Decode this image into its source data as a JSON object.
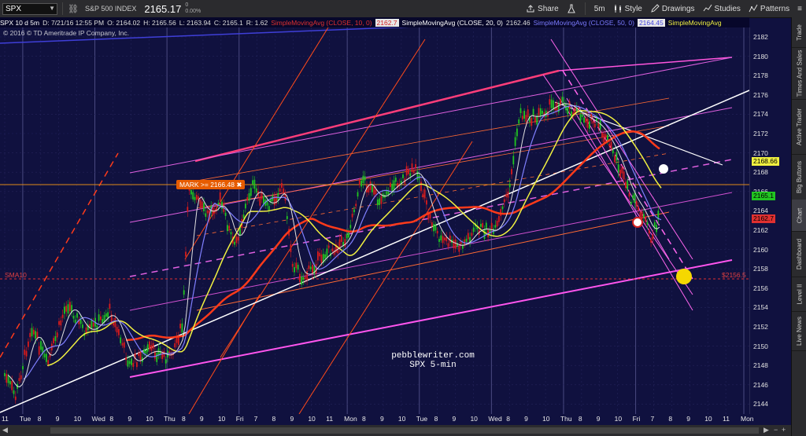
{
  "toolbar": {
    "symbol": "SPX",
    "index_name": "S&P 500 INDEX",
    "last_price": "2165.17",
    "change_value": "0",
    "change_pct": "0.00%",
    "buttons": {
      "share": "Share",
      "interval": "5m",
      "style": "Style",
      "drawings": "Drawings",
      "studies": "Studies",
      "patterns": "Patterns"
    }
  },
  "infobar": {
    "symbol_period": "SPX 10 d 5m",
    "date": "D: 7/21/16 12:55 PM",
    "open": "O: 2164.02",
    "high": "H: 2165.56",
    "low": "L: 2163.94",
    "close": "C: 2165.1",
    "range": "R: 1.62",
    "sma10_label": "SimpleMovingAvg (CLOSE, 10, 0)",
    "sma10_value": "2162.7",
    "sma20_label": "SimpleMovingAvg (CLOSE, 20, 0)",
    "sma20_value": "2162.46",
    "sma50_label": "SimpleMovingAvg (CLOSE, 50, 0)",
    "sma50_value": "2164.45",
    "sma_extra": "SimpleMovingAvg"
  },
  "copyright": "© 2016 © TD Ameritrade IP Company, Inc.",
  "price_axis": {
    "ticks": [
      "2182",
      "2180",
      "2178",
      "2176",
      "2174",
      "2172",
      "2170",
      "2168",
      "2166",
      "2164",
      "2162",
      "2160",
      "2158",
      "2156",
      "2154",
      "2152",
      "2150",
      "2148",
      "2146",
      "2144"
    ],
    "tags": {
      "yellow": "2168.66",
      "green": "2165.1",
      "red": "2162.7"
    }
  },
  "time_axis": {
    "labels": [
      "11",
      "Tue",
      "8",
      "9",
      "10",
      "Wed",
      "8",
      "9",
      "10",
      "Thu",
      "8",
      "9",
      "10",
      "Fri",
      "7",
      "8",
      "9",
      "10",
      "11",
      "Mon",
      "8",
      "9",
      "10",
      "Tue",
      "8",
      "9",
      "10",
      "Wed",
      "8",
      "9",
      "10",
      "Thu",
      "8",
      "9",
      "10",
      "Fri",
      "7",
      "8",
      "9",
      "10",
      "11",
      "Mon"
    ]
  },
  "annotations": {
    "mark": "MARK >= 2166.48",
    "sma10_tag": "SMA10",
    "level_tag": "$2156.5",
    "watermark_line1": "pebblewriter.com",
    "watermark_line2": "SPX 5-min"
  },
  "right_panel": {
    "tabs": [
      "Trade",
      "Times And Sales",
      "Active Trader",
      "Big Buttons",
      "Chart",
      "Dashboard",
      "Level II",
      "Live News"
    ]
  },
  "colors": {
    "background": "#10113f",
    "candle_up": "#21c521",
    "candle_down": "#d81b1b",
    "sma10": "#e0e0e0",
    "sma20": "#8080ff",
    "sma50": "#f0f040",
    "sma_long": "#ff3a1a"
  }
}
